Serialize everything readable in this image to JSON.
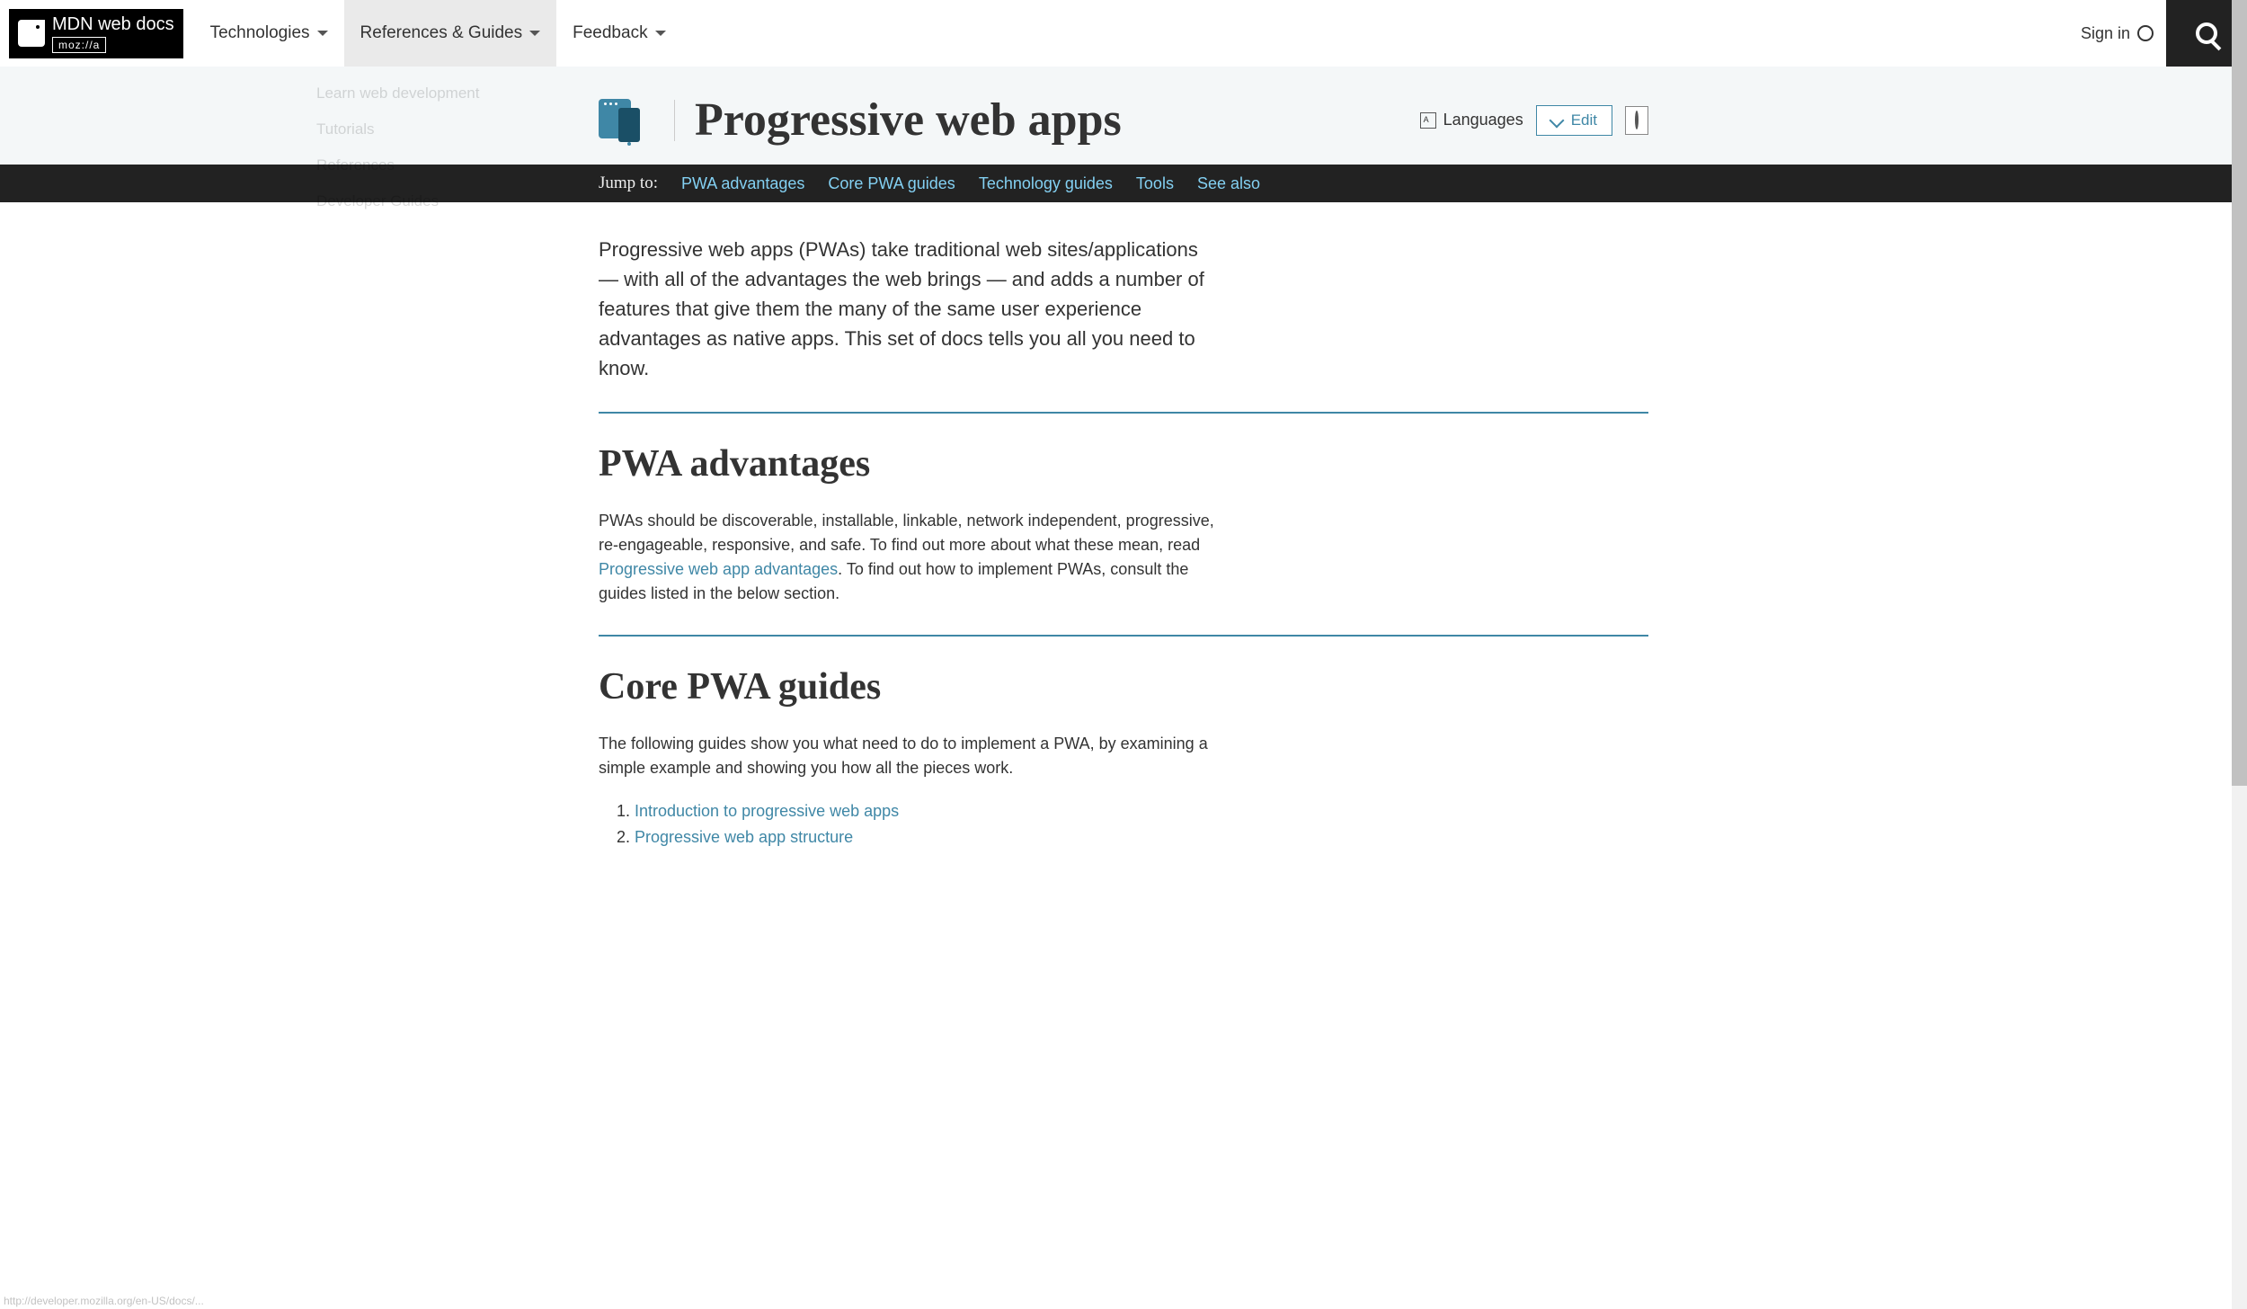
{
  "topnav": {
    "logo_top": "MDN web docs",
    "logo_bottom": "moz://a",
    "items": [
      "Technologies",
      "References & Guides",
      "Feedback"
    ],
    "signin": "Sign in"
  },
  "dropdown": {
    "items": [
      "Learn web development",
      "Tutorials",
      "References",
      "Developer Guides"
    ]
  },
  "header": {
    "title": "Progressive web apps",
    "languages": "Languages",
    "edit": "Edit"
  },
  "jumpto": {
    "label": "Jump to:",
    "links": [
      "PWA advantages",
      "Core PWA guides",
      "Technology guides",
      "Tools",
      "See also"
    ]
  },
  "intro": "Progressive web apps (PWAs) take traditional web sites/applications — with all of the advantages the web brings — and adds a number of features  that give them the many of the same user experience advantages as native apps. This set of docs tells you all you need to know.",
  "s1": {
    "heading": "PWA advantages",
    "p1": "PWAs should be discoverable, installable, linkable, network independent, progressive, re-engageable, responsive, and safe. To find out more about what these mean, read ",
    "link": "Progressive web app advantages",
    "p2": ". To find out how to implement PWAs, consult the guides listed in the below section."
  },
  "s2": {
    "heading": "Core PWA guides",
    "p1": "The following guides show you what need to do to implement a PWA, by examining a simple example and showing you how all the pieces work.",
    "g1": "Introduction to progressive web apps",
    "g2": "Progressive web app structure"
  },
  "status": "http://developer.mozilla.org/en-US/docs/..."
}
